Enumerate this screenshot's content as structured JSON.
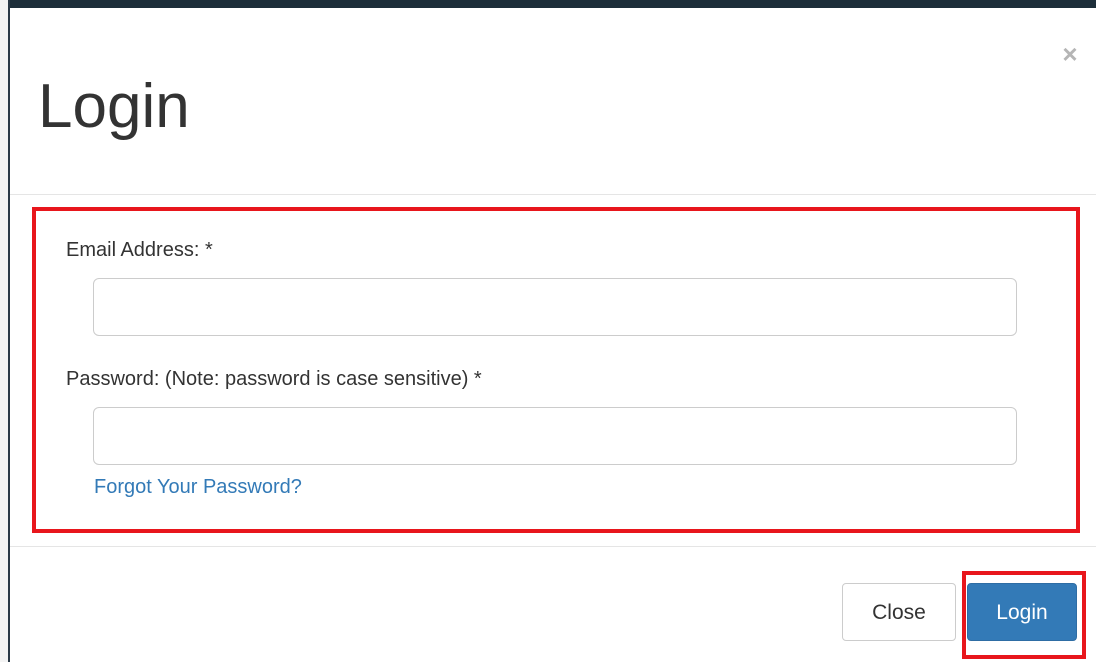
{
  "modal": {
    "title": "Login",
    "close_icon_glyph": "×"
  },
  "form": {
    "email_label": "Email Address:  *",
    "email_value": "",
    "email_placeholder": "",
    "password_label": "Password: (Note: password is case sensitive)  *",
    "password_value": "",
    "password_placeholder": "",
    "forgot_link": "Forgot Your Password?"
  },
  "footer": {
    "close_label": "Close",
    "login_label": "Login"
  },
  "colors": {
    "primary": "#337ab7",
    "highlight": "#e8161c",
    "link": "#337ab7"
  },
  "icons": {
    "close": "close-icon"
  }
}
